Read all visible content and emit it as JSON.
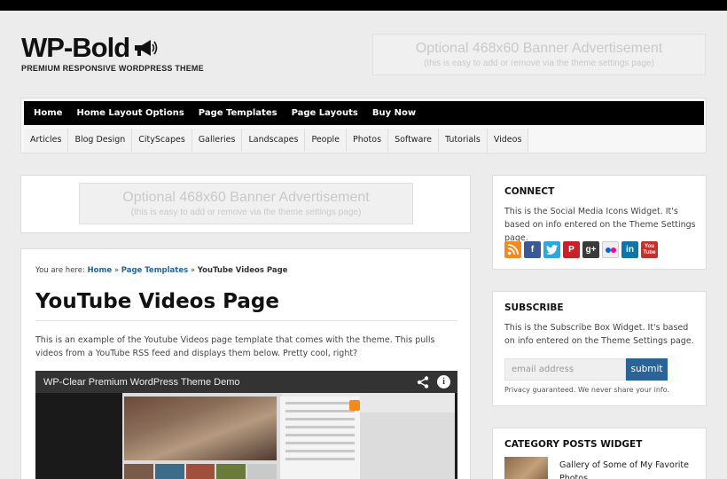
{
  "header": {
    "logo_title": "WP-Bold",
    "logo_tagline": "PREMIUM RESPONSIVE WORDPRESS THEME",
    "banner_line1": "Optional 468x60 Banner Advertisement",
    "banner_line2": "(this is easy to add or remove via the theme settings page)"
  },
  "nav_primary": [
    "Home",
    "Home Layout Options",
    "Page Templates",
    "Page Layouts",
    "Buy Now"
  ],
  "nav_secondary": [
    "Articles",
    "Blog Design",
    "CityScapes",
    "Galleries",
    "Landscapes",
    "People",
    "Photos",
    "Software",
    "Tutorials",
    "Videos"
  ],
  "content_banner": {
    "line1": "Optional 468x60 Banner Advertisement",
    "line2": "(this is easy to add or remove via the theme settings page)"
  },
  "breadcrumb": {
    "prefix": "You are here:",
    "home": "Home",
    "sep1": "»",
    "parent": "Page Templates",
    "sep2": "»",
    "current": "YouTube Videos Page"
  },
  "page": {
    "title": "YouTube Videos Page",
    "intro": "This is an example of the Youtube Videos page template that comes with the theme. This pulls videos from a YouTube RSS feed and displays them below. Pretty cool, right?"
  },
  "video": {
    "title": "WP-Clear Premium WordPress Theme Demo",
    "info_glyph": "i",
    "share_icon": "share-icon"
  },
  "sidebar": {
    "connect": {
      "title": "CONNECT",
      "text": "This is the Social Media Icons Widget. It's based on info entered on the Theme Settings page.",
      "icons": [
        "rss-icon",
        "facebook-icon",
        "twitter-icon",
        "pinterest-icon",
        "google-plus-icon",
        "flickr-icon",
        "linkedin-icon",
        "youtube-icon"
      ],
      "icon_glyphs": {
        "facebook": "f",
        "pinterest": "P",
        "google_plus": "g+",
        "linkedin": "in",
        "youtube_1": "You",
        "youtube_2": "Tube"
      }
    },
    "subscribe": {
      "title": "SUBSCRIBE",
      "text": "This is the Subscribe Box Widget. It's based on info entered on the Theme Settings page.",
      "placeholder": "email address",
      "button": "submit",
      "note": "Privacy guaranteed. We never share your info."
    },
    "category": {
      "title": "CATEGORY POSTS WIDGET",
      "post_title": "Gallery of Some of My Favorite Photos"
    }
  },
  "colors": {
    "accent": "#2a6496",
    "nav_bg": "#000000",
    "page_bg": "#ececec"
  }
}
